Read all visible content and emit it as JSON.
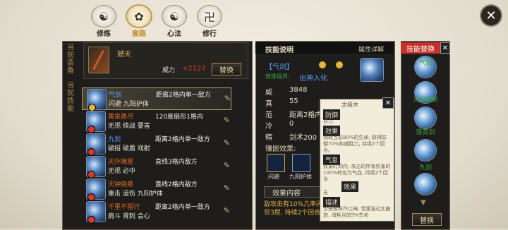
{
  "tabs": [
    {
      "label": "修炼",
      "glyph": "☯"
    },
    {
      "label": "套路",
      "glyph": "✿"
    },
    {
      "label": "心法",
      "glyph": "☯"
    },
    {
      "label": "修行",
      "glyph": "卍"
    }
  ],
  "left": {
    "equip_label": "当前装备",
    "weapon_name": "撼天",
    "power_label": "威力",
    "power_value": "+2127",
    "replace_btn": "替换",
    "skills_label": "当前技能",
    "skills": [
      {
        "name": "气剑",
        "tags": "闪避 九阳护体",
        "desc": "距离2格内单一敌方",
        "tags2": ""
      },
      {
        "name": "黄泉路尽",
        "tags": "无视 续战 要害",
        "desc": "120度扇形1格内",
        "tags2": ""
      },
      {
        "name": "九剑",
        "tags": "破招 破盾 戏射",
        "desc": "距离2格内单一敌方",
        "tags2": ""
      },
      {
        "name": "天外摘星",
        "tags": "无视 必中",
        "desc": "直线3格内敌方",
        "tags2": ""
      },
      {
        "name": "天钟倒悬",
        "tags": "重击 追伤 九阳护体",
        "desc": "直线2格内敌方",
        "tags2": ""
      },
      {
        "name": "千里不留行",
        "tags": "肩斗 背刺 会心",
        "desc": "距离2格内单一敌方",
        "tags2": ""
      }
    ]
  },
  "detail": {
    "header": "技能说明",
    "attr_tab": "属性详解",
    "skill_name": "【气剑】",
    "realm_label": "修炼境界:",
    "realm_value": "出神入化",
    "stats": [
      {
        "k": "威",
        "v": "3848"
      },
      {
        "k": "真",
        "v": "55"
      },
      {
        "k": "范",
        "v": "距离2格内"
      },
      {
        "k": "冷",
        "v": "0"
      },
      {
        "k": "精",
        "v": "剑术200"
      }
    ],
    "inlay_label": "镶嵌效果:",
    "inlays": [
      "闪避",
      "九阳护体"
    ],
    "effect_tab": "效果内容",
    "effect_text": "敌攻击有10%几率闪避,",
    "effect_text2": "穷3层, 持续2个回合",
    "close": "✕"
  },
  "popup": {
    "title": "太极木",
    "sec1": "防御",
    "sec1_sub": "自己",
    "sec2": "效果",
    "sec2_text": "消耗当前80%的生命, 获得防御70%和威胜力, 持续2个回合。",
    "sec3": "气息",
    "sec3_text": "效果时间内, 攻击的所有伤害的100%转化为气血, 持续2个回合",
    "sec4": "效果",
    "sec4_text": "无",
    "sec5": "描述",
    "sec5_text": "艺无极纵作江梅, 雪里溪过太曲旅, 消耗当前5%生命",
    "close": "✕"
  },
  "right": {
    "header": "技能替换",
    "close": "✕",
    "items": [
      "气剑",
      "天剑神斩",
      "落英剑",
      "九剑"
    ],
    "bottom_btn": "替换"
  }
}
